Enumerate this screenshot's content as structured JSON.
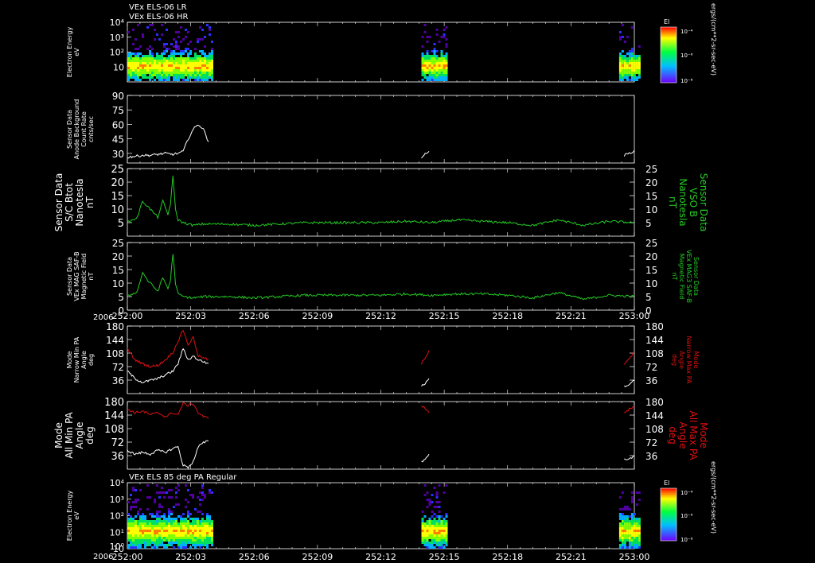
{
  "titles": {
    "top1": "VEx ELS-06 LR",
    "top2": "VEx ELS-06 HR",
    "bottom": "VEx ELS 85 deg PA Regular"
  },
  "colorbar": {
    "label": "El",
    "units": "ergs/(cm**2-sr-sec-eV)",
    "ticks": [
      "10⁻⁴",
      "10⁻⁶",
      "10⁻⁸"
    ]
  },
  "x_axis": {
    "year": "2006",
    "ticks": [
      "252:00",
      "252:03",
      "252:06",
      "252:09",
      "252:12",
      "252:15",
      "252:18",
      "252:21",
      "253:00"
    ]
  },
  "colors": {
    "white": "#ffffff",
    "green": "#22cc22",
    "red": "#dd1111",
    "background": "#000000"
  },
  "chart_data": [
    {
      "id": "spec1",
      "type": "heatmap",
      "ylabel": [
        "Electron Energy",
        "eV"
      ],
      "yticks": [
        "10⁴",
        "10³",
        "10²",
        "10"
      ],
      "ylog": true,
      "ylim": [
        1,
        10000
      ],
      "x_coverage_hours": [
        [
          0.0,
          0.33
        ],
        [
          1.16,
          1.26
        ],
        [
          1.94,
          2.02
        ]
      ]
    },
    {
      "id": "bgcounts",
      "type": "line",
      "ylabel": [
        "Sensor Data",
        "Anode Background",
        "Count Rate",
        "cnts/sec"
      ],
      "ylim": [
        20,
        90
      ],
      "yticks": [
        90,
        75,
        60,
        45,
        30
      ],
      "series": [
        {
          "color": "white",
          "x": [
            0.0,
            0.03,
            0.06,
            0.09,
            0.12,
            0.15,
            0.18,
            0.2,
            0.22,
            0.24,
            0.26,
            0.28,
            0.3,
            0.32
          ],
          "y": [
            26,
            27,
            28,
            28,
            29,
            30,
            29,
            30,
            32,
            45,
            55,
            60,
            55,
            42
          ]
        },
        {
          "color": "white",
          "x": [
            1.16,
            1.18,
            1.19
          ],
          "y": [
            26,
            30,
            32
          ]
        },
        {
          "color": "white",
          "x": [
            1.96,
            1.98,
            2.0
          ],
          "y": [
            28,
            30,
            33
          ]
        }
      ]
    },
    {
      "id": "bmag1",
      "type": "line",
      "ylabel": [
        "Sensor Data",
        "S/C Btot",
        "Nanotesla",
        "nT"
      ],
      "ylabel_right": [
        "Sensor Data",
        "VSO B",
        "Nanotesla",
        "nT"
      ],
      "ylim": [
        0,
        25
      ],
      "yticks": [
        25,
        20,
        15,
        10,
        5
      ],
      "series": [
        {
          "color": "green",
          "x": [
            0.0,
            0.02,
            0.04,
            0.06,
            0.08,
            0.1,
            0.12,
            0.14,
            0.16,
            0.17,
            0.18,
            0.19,
            0.2,
            0.22,
            0.26,
            0.3,
            0.4,
            0.5,
            0.6,
            0.7,
            0.8,
            0.9,
            1.0,
            1.1,
            1.2,
            1.3,
            1.4,
            1.5,
            1.6,
            1.7,
            1.8,
            1.9,
            2.0
          ],
          "y": [
            5,
            6,
            7,
            13,
            11,
            9,
            7,
            13,
            8,
            12,
            22,
            10,
            6,
            5,
            4,
            4.5,
            4.5,
            4,
            4.5,
            5,
            5,
            5,
            5,
            5.5,
            5,
            6,
            5.5,
            5,
            4,
            6,
            4,
            5.5,
            5
          ]
        }
      ]
    },
    {
      "id": "bmag2",
      "type": "line",
      "ylabel": [
        "Sensor Data",
        "VEx MAG SAF-B",
        "Magnetic Field",
        "nT"
      ],
      "ylabel_right": [
        "Sensor Data",
        "VEx MAG3 SAF-B",
        "Magnetic Field",
        "nT"
      ],
      "ylim": [
        0,
        25
      ],
      "yticks": [
        25,
        20,
        15,
        10,
        5,
        0
      ],
      "series": [
        {
          "color": "green",
          "x": [
            0.0,
            0.02,
            0.04,
            0.06,
            0.08,
            0.1,
            0.12,
            0.14,
            0.16,
            0.17,
            0.18,
            0.19,
            0.2,
            0.22,
            0.26,
            0.3,
            0.4,
            0.5,
            0.6,
            0.7,
            0.8,
            0.9,
            1.0,
            1.1,
            1.2,
            1.3,
            1.4,
            1.5,
            1.6,
            1.7,
            1.8,
            1.9,
            2.0
          ],
          "y": [
            5,
            6,
            7,
            14,
            11,
            9,
            7,
            12,
            8,
            11,
            21,
            10,
            6,
            5,
            4.5,
            5,
            5,
            4.5,
            5,
            5.5,
            5.5,
            5.5,
            5.5,
            6,
            5.5,
            6,
            6,
            5.5,
            4.5,
            6.5,
            4,
            5.5,
            5
          ]
        }
      ]
    },
    {
      "id": "pa_narrow",
      "type": "line",
      "ylabel": [
        "Mode",
        "Narrow Min PA",
        "Angle",
        "deg"
      ],
      "ylabel_right": [
        "Mode",
        "Narrow Max PA",
        "Angle",
        "deg"
      ],
      "ylim": [
        0,
        180
      ],
      "yticks": [
        180,
        144,
        108,
        72,
        36
      ],
      "series": [
        {
          "color": "red",
          "x": [
            0.0,
            0.03,
            0.06,
            0.09,
            0.12,
            0.15,
            0.18,
            0.2,
            0.22,
            0.24,
            0.26,
            0.28,
            0.3,
            0.32
          ],
          "y": [
            120,
            90,
            80,
            72,
            75,
            90,
            110,
            140,
            170,
            130,
            150,
            100,
            95,
            90
          ]
        },
        {
          "color": "white",
          "x": [
            0.0,
            0.03,
            0.06,
            0.09,
            0.12,
            0.15,
            0.18,
            0.2,
            0.22,
            0.24,
            0.26,
            0.28,
            0.3,
            0.32
          ],
          "y": [
            60,
            40,
            30,
            35,
            40,
            50,
            60,
            80,
            120,
            90,
            100,
            90,
            85,
            80
          ]
        },
        {
          "color": "red",
          "x": [
            1.16,
            1.18,
            1.19
          ],
          "y": [
            80,
            100,
            115
          ]
        },
        {
          "color": "white",
          "x": [
            1.16,
            1.18,
            1.19
          ],
          "y": [
            20,
            30,
            40
          ]
        },
        {
          "color": "red",
          "x": [
            1.96,
            1.98,
            2.0
          ],
          "y": [
            80,
            95,
            110
          ]
        },
        {
          "color": "white",
          "x": [
            1.96,
            1.98,
            2.0
          ],
          "y": [
            20,
            25,
            35
          ]
        }
      ]
    },
    {
      "id": "pa_all",
      "type": "line",
      "ylabel": [
        "Mode",
        "All Min PA",
        "Angle",
        "deg"
      ],
      "ylabel_right": [
        "Mode",
        "All Max PA",
        "Angle",
        "deg"
      ],
      "ylim": [
        0,
        180
      ],
      "yticks": [
        180,
        144,
        108,
        72,
        36
      ],
      "series": [
        {
          "color": "red",
          "x": [
            0.0,
            0.03,
            0.06,
            0.09,
            0.12,
            0.15,
            0.18,
            0.2,
            0.22,
            0.24,
            0.26,
            0.28,
            0.3,
            0.32
          ],
          "y": [
            160,
            150,
            155,
            145,
            150,
            140,
            150,
            145,
            175,
            170,
            175,
            150,
            140,
            135
          ]
        },
        {
          "color": "white",
          "x": [
            0.0,
            0.03,
            0.06,
            0.09,
            0.12,
            0.15,
            0.18,
            0.2,
            0.22,
            0.24,
            0.26,
            0.28,
            0.3,
            0.32
          ],
          "y": [
            50,
            40,
            45,
            40,
            50,
            45,
            55,
            60,
            10,
            5,
            20,
            60,
            70,
            75
          ]
        },
        {
          "color": "red",
          "x": [
            1.16,
            1.18,
            1.19
          ],
          "y": [
            170,
            160,
            150
          ]
        },
        {
          "color": "white",
          "x": [
            1.16,
            1.18,
            1.19
          ],
          "y": [
            20,
            30,
            40
          ]
        },
        {
          "color": "red",
          "x": [
            1.96,
            1.98,
            2.0
          ],
          "y": [
            150,
            160,
            165
          ]
        },
        {
          "color": "white",
          "x": [
            1.96,
            1.98,
            2.0
          ],
          "y": [
            30,
            25,
            35
          ]
        }
      ]
    },
    {
      "id": "spec2",
      "type": "heatmap",
      "ylabel": [
        "Electron Energy",
        "eV"
      ],
      "yticks": [
        "10⁴",
        "10³",
        "10²",
        "10¹",
        "10⁰",
        "10"
      ],
      "ylog": true,
      "ylim": [
        1,
        10000
      ],
      "x_coverage_hours": [
        [
          0.0,
          0.33
        ],
        [
          1.16,
          1.26
        ],
        [
          1.94,
          2.02
        ]
      ]
    }
  ]
}
